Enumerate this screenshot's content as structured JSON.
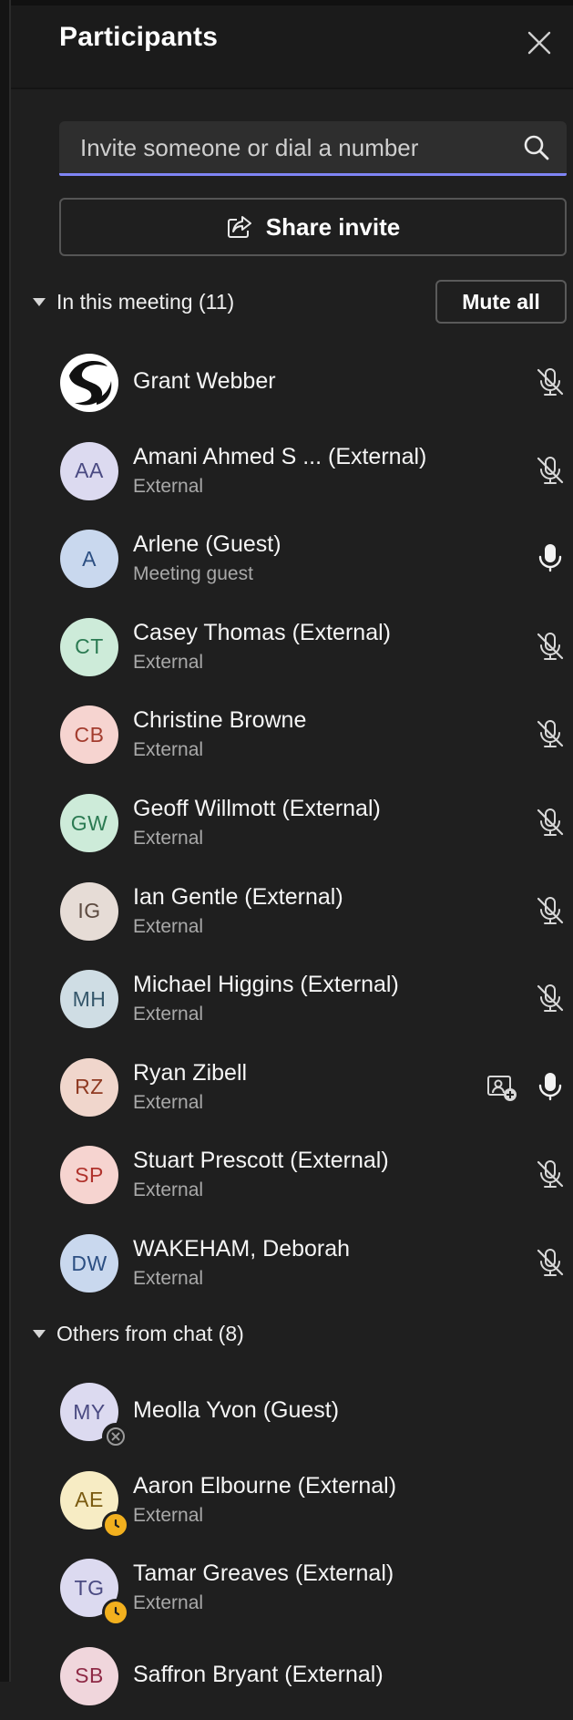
{
  "panel": {
    "title": "Participants",
    "search_placeholder": "Invite someone or dial a number",
    "share_label": "Share invite"
  },
  "in_meeting": {
    "label": "In this meeting (11)",
    "mute_all_label": "Mute all",
    "participants": [
      {
        "name": "Grant Webber",
        "subtitle": "",
        "initials": "",
        "avatar": "logo",
        "mic": "muted"
      },
      {
        "name": "Amani Ahmed S ... (External)",
        "subtitle": "External",
        "initials": "AA",
        "bg": "#dcdaf0",
        "fg": "#4a4a82",
        "mic": "muted"
      },
      {
        "name": "Arlene (Guest)",
        "subtitle": "Meeting guest",
        "initials": "A",
        "bg": "#c9d8ee",
        "fg": "#2c4f82",
        "mic": "on"
      },
      {
        "name": "Casey Thomas (External)",
        "subtitle": "External",
        "initials": "CT",
        "bg": "#cdebd9",
        "fg": "#2b7a52",
        "mic": "muted"
      },
      {
        "name": "Christine Browne",
        "subtitle": "External",
        "initials": "CB",
        "bg": "#f6d4d0",
        "fg": "#a33c2e",
        "mic": "muted"
      },
      {
        "name": "Geoff Willmott (External)",
        "subtitle": "External",
        "initials": "GW",
        "bg": "#cdebd9",
        "fg": "#2b7a52",
        "mic": "muted"
      },
      {
        "name": "Ian Gentle (External)",
        "subtitle": "External",
        "initials": "IG",
        "bg": "#e6dcd6",
        "fg": "#5c4a40",
        "mic": "muted"
      },
      {
        "name": "Michael Higgins (External)",
        "subtitle": "External",
        "initials": "MH",
        "bg": "#cfdde4",
        "fg": "#34566a",
        "mic": "muted"
      },
      {
        "name": "Ryan Zibell",
        "subtitle": "External",
        "initials": "RZ",
        "bg": "#f0d6cc",
        "fg": "#8f3a22",
        "mic": "on",
        "sharing": true
      },
      {
        "name": "Stuart Prescott (External)",
        "subtitle": "External",
        "initials": "SP",
        "bg": "#f6d4d0",
        "fg": "#b0322c",
        "mic": "muted"
      },
      {
        "name": "WAKEHAM, Deborah",
        "subtitle": "External",
        "initials": "DW",
        "bg": "#c9d8ee",
        "fg": "#2c4f82",
        "mic": "muted"
      }
    ]
  },
  "others": {
    "label": "Others from chat (8)",
    "participants": [
      {
        "name": "Meolla Yvon (Guest)",
        "subtitle": "",
        "initials": "MY",
        "bg": "#dcdaf0",
        "fg": "#4a4a82",
        "presence": "offline"
      },
      {
        "name": "Aaron Elbourne (External)",
        "subtitle": "External",
        "initials": "AE",
        "bg": "#f7ecc4",
        "fg": "#7a5a10",
        "presence": "away"
      },
      {
        "name": "Tamar Greaves (External)",
        "subtitle": "External",
        "initials": "TG",
        "bg": "#dcdaf0",
        "fg": "#4a4a82",
        "presence": "away"
      },
      {
        "name": "Saffron Bryant (External)",
        "subtitle": "",
        "initials": "SB",
        "bg": "#f0d6dc",
        "fg": "#8f2a46",
        "presence": ""
      }
    ]
  },
  "icons": {
    "close": "close-icon",
    "search": "search-icon",
    "share": "share-icon",
    "mic_on": "mic-icon",
    "mic_muted": "mic-off-icon",
    "screen_share": "screen-share-icon",
    "away": "clock-icon",
    "offline": "offline-icon"
  },
  "colors": {
    "background": "#1f1f1f",
    "accent": "#7f85f5",
    "away": "#f2b01e"
  }
}
